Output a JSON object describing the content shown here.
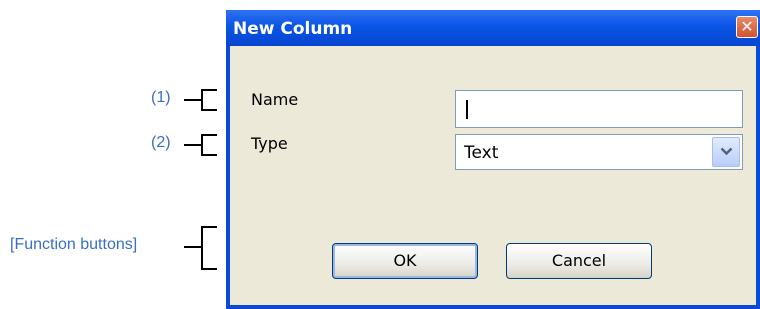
{
  "annotations": {
    "name_marker": "(1)",
    "type_marker": "(2)",
    "buttons_marker": "[Function buttons]"
  },
  "dialog": {
    "title": "New Column",
    "close_glyph": "✕",
    "fields": {
      "name_label": "Name",
      "name_value": "",
      "type_label": "Type",
      "type_value": "Text"
    },
    "buttons": {
      "ok_label": "OK",
      "cancel_label": "Cancel"
    }
  },
  "colors": {
    "titlebar": "#0a55e6",
    "client_bg": "#ece9d8",
    "annotation_text": "#3a6fc4",
    "close_button": "#d2522f"
  }
}
